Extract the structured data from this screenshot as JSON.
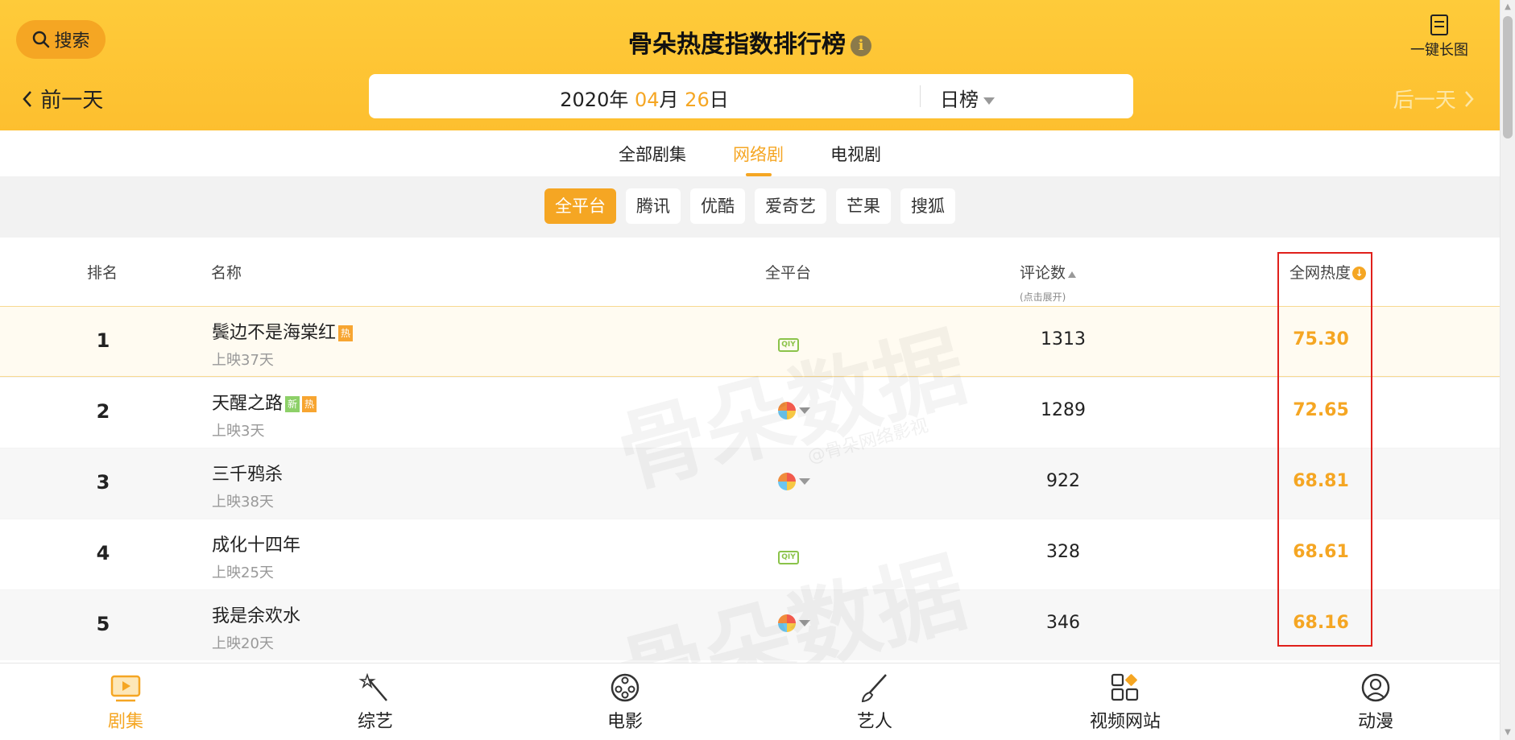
{
  "header": {
    "search_label": "搜索",
    "title": "骨朵热度指数排行榜",
    "long_image_label": "一键长图",
    "prev_day": "前一天",
    "next_day": "后一天",
    "date": {
      "year": "2020",
      "year_unit": "年",
      "month": "04",
      "month_unit": "月",
      "day": "26",
      "day_unit": "日"
    },
    "board": "日榜"
  },
  "category_tabs": [
    {
      "label": "全部剧集",
      "active": false
    },
    {
      "label": "网络剧",
      "active": true
    },
    {
      "label": "电视剧",
      "active": false
    }
  ],
  "platforms": [
    {
      "label": "全平台",
      "active": true
    },
    {
      "label": "腾讯",
      "active": false
    },
    {
      "label": "优酷",
      "active": false
    },
    {
      "label": "爱奇艺",
      "active": false
    },
    {
      "label": "芒果",
      "active": false
    },
    {
      "label": "搜狐",
      "active": false
    }
  ],
  "table": {
    "headers": {
      "rank": "排名",
      "name": "名称",
      "platform": "全平台",
      "comments": "评论数",
      "comments_sub": "(点击展开)",
      "heat": "全网热度"
    },
    "rows": [
      {
        "rank": "1",
        "name": "鬓边不是海棠红",
        "tags": [
          "热"
        ],
        "days": "上映37天",
        "platform_icon": "iqiyi-icon",
        "platform_text": "QIY",
        "comments": "1313",
        "heat": "75.30"
      },
      {
        "rank": "2",
        "name": "天醒之路",
        "tags": [
          "新",
          "热"
        ],
        "days": "上映3天",
        "platform_icon": "multi-platform-icon",
        "platform_text": "",
        "comments": "1289",
        "heat": "72.65"
      },
      {
        "rank": "3",
        "name": "三千鸦杀",
        "tags": [],
        "days": "上映38天",
        "platform_icon": "multi-platform-icon",
        "platform_text": "",
        "comments": "922",
        "heat": "68.81"
      },
      {
        "rank": "4",
        "name": "成化十四年",
        "tags": [],
        "days": "上映25天",
        "platform_icon": "iqiyi-icon",
        "platform_text": "QIY",
        "comments": "328",
        "heat": "68.61"
      },
      {
        "rank": "5",
        "name": "我是余欢水",
        "tags": [],
        "days": "上映20天",
        "platform_icon": "multi-platform-icon",
        "platform_text": "",
        "comments": "346",
        "heat": "68.16"
      }
    ]
  },
  "watermark": {
    "text": "骨朵数据",
    "sub": "@骨朵网络影视"
  },
  "bottom_nav": [
    {
      "label": "剧集",
      "icon": "tv-play-icon",
      "active": true
    },
    {
      "label": "综艺",
      "icon": "magic-wand-icon",
      "active": false
    },
    {
      "label": "电影",
      "icon": "film-reel-icon",
      "active": false
    },
    {
      "label": "艺人",
      "icon": "brush-icon",
      "active": false
    },
    {
      "label": "视频网站",
      "icon": "apps-grid-icon",
      "active": false
    },
    {
      "label": "动漫",
      "icon": "user-circle-icon",
      "active": false
    }
  ],
  "colors": {
    "brand": "#f5a623",
    "header_bg": "#fecb3a",
    "highlight_border": "#e0201b"
  }
}
